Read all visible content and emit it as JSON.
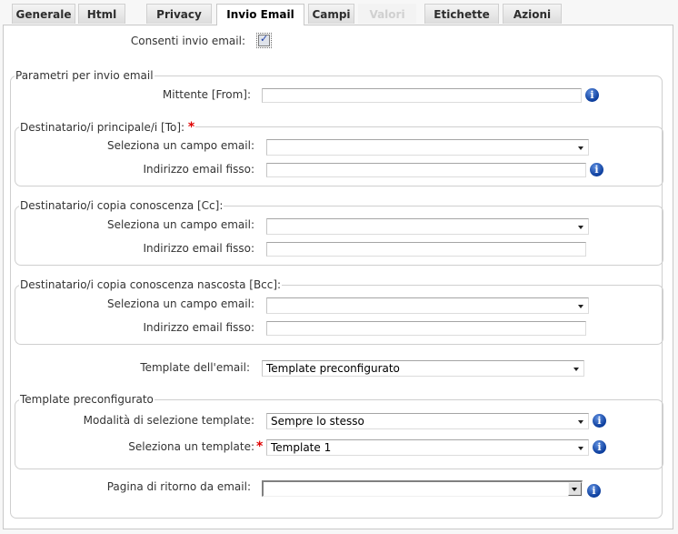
{
  "tabs": [
    {
      "label": "Generale",
      "state": "normal"
    },
    {
      "label": "Html",
      "state": "normal"
    },
    {
      "label": "Privacy",
      "state": "normal"
    },
    {
      "label": "Invio Email",
      "state": "active"
    },
    {
      "label": "Campi",
      "state": "normal"
    },
    {
      "label": "Valori",
      "state": "disabled"
    },
    {
      "label": "Etichette",
      "state": "normal"
    },
    {
      "label": "Azioni",
      "state": "normal"
    }
  ],
  "allow_email": {
    "label": "Consenti invio email:",
    "checked": true,
    "check_glyph": "✓"
  },
  "params": {
    "legend": "Parametri per invio email",
    "sender": {
      "label": "Mittente [From]:",
      "value": ""
    },
    "to": {
      "legend": "Destinatario/i principale/i [To]:",
      "required_mark": "*",
      "field_select_label": "Seleziona un campo email:",
      "field_select_value": "",
      "fixed_address_label": "Indirizzo email fisso:",
      "fixed_address_value": ""
    },
    "cc": {
      "legend": "Destinatario/i copia conoscenza [Cc]:",
      "field_select_label": "Seleziona un campo email:",
      "field_select_value": "",
      "fixed_address_label": "Indirizzo email fisso:",
      "fixed_address_value": ""
    },
    "bcc": {
      "legend": "Destinatario/i copia conoscenza nascosta [Bcc]:",
      "field_select_label": "Seleziona un campo email:",
      "field_select_value": "",
      "fixed_address_label": "Indirizzo email fisso:",
      "fixed_address_value": ""
    },
    "template": {
      "label": "Template dell'email:",
      "value": "Template preconfigurato"
    },
    "preconfigured": {
      "legend": "Template preconfigurato",
      "mode_label": "Modalità di selezione template:",
      "mode_value": "Sempre lo stesso",
      "template_label": "Seleziona un template:",
      "required_mark": "*",
      "template_value": "Template 1"
    },
    "return_page": {
      "label": "Pagina di ritorno da email:",
      "value": ""
    }
  },
  "icons": {
    "info": "i"
  }
}
